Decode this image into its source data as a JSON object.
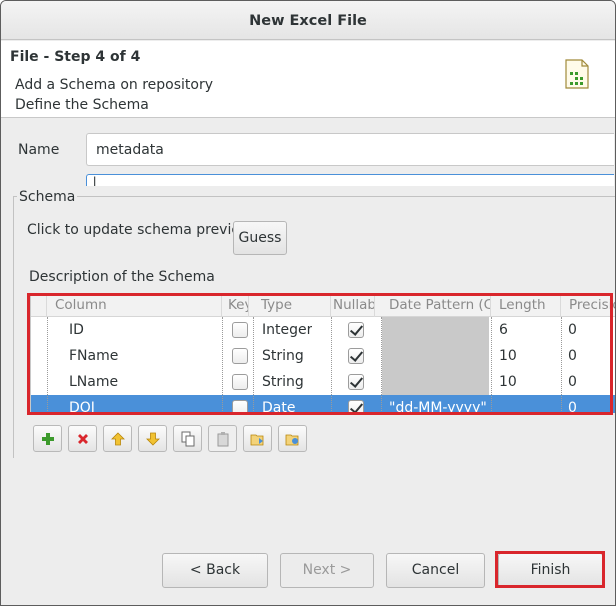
{
  "window": {
    "title": "New Excel File"
  },
  "header": {
    "step_title": "File - Step 4 of 4",
    "line1": "Add a Schema on repository",
    "line2": "Define the Schema"
  },
  "form": {
    "name_label": "Name",
    "name_value": "metadata",
    "comment_value": "l"
  },
  "schema": {
    "legend": "Schema",
    "update_label": "Click to update schema preview",
    "guess_label": "Guess",
    "description_label": "Description of the Schema",
    "columns": [
      "Column",
      "Key",
      "Type",
      "Nullable",
      "Date Pattern (Ctrl+Space available)",
      "Length",
      "Precision"
    ],
    "rows": [
      {
        "column": "ID",
        "key": false,
        "type": "Integer",
        "nullable": true,
        "date_pattern": "",
        "length": "6",
        "precision": "0",
        "selected": false
      },
      {
        "column": "FName",
        "key": false,
        "type": "String",
        "nullable": true,
        "date_pattern": "",
        "length": "10",
        "precision": "0",
        "selected": false
      },
      {
        "column": "LName",
        "key": false,
        "type": "String",
        "nullable": true,
        "date_pattern": "",
        "length": "10",
        "precision": "0",
        "selected": false
      },
      {
        "column": "DOJ",
        "key": false,
        "type": "Date",
        "nullable": true,
        "date_pattern": "\"dd-MM-yyyy\"",
        "length": "",
        "precision": "0",
        "selected": true
      }
    ],
    "toolbar": [
      {
        "name": "add-row-icon",
        "color": "#3c9a2c"
      },
      {
        "name": "remove-row-icon",
        "color": "#d9262c"
      },
      {
        "name": "move-up-icon",
        "color": "#e3a81d"
      },
      {
        "name": "move-down-icon",
        "color": "#e3a81d"
      },
      {
        "name": "copy-icon",
        "color": "#6a6a6a"
      },
      {
        "name": "paste-icon",
        "color": "#9a9a9a"
      },
      {
        "name": "import-schema-icon",
        "color": "#4a90d9"
      },
      {
        "name": "export-schema-icon",
        "color": "#4a90d9"
      }
    ]
  },
  "footer": {
    "back_label": "< Back",
    "next_label": "Next >",
    "cancel_label": "Cancel",
    "finish_label": "Finish"
  },
  "colors": {
    "selection": "#4a90d9",
    "highlight": "#d9262c"
  }
}
